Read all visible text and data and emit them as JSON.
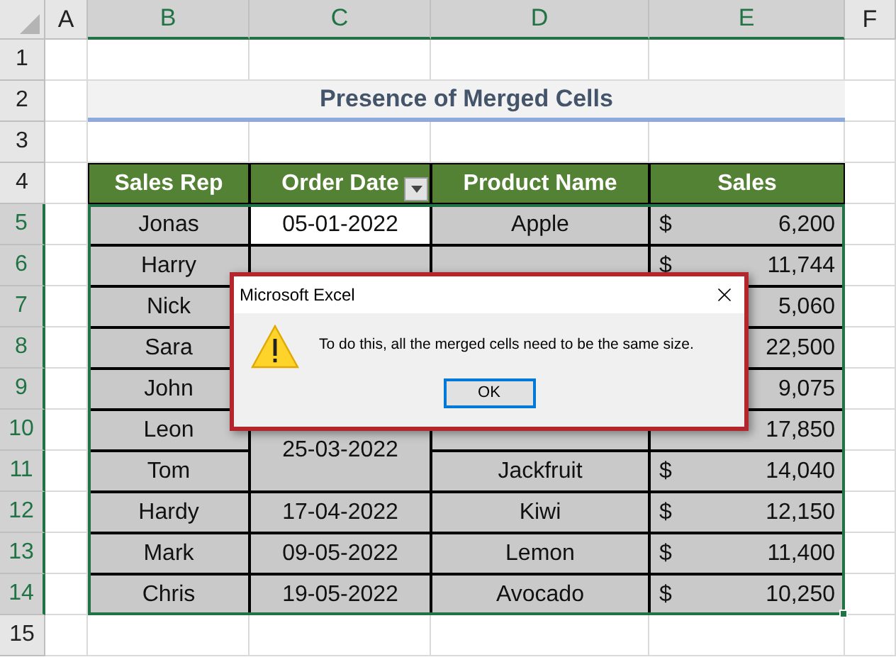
{
  "column_headers": [
    {
      "label": "A",
      "selected": false
    },
    {
      "label": "B",
      "selected": true
    },
    {
      "label": "C",
      "selected": true
    },
    {
      "label": "D",
      "selected": true
    },
    {
      "label": "E",
      "selected": true
    },
    {
      "label": "F",
      "selected": false
    }
  ],
  "row_headers": [
    {
      "label": "1",
      "selected": false
    },
    {
      "label": "2",
      "selected": false
    },
    {
      "label": "3",
      "selected": false
    },
    {
      "label": "4",
      "selected": false
    },
    {
      "label": "5",
      "selected": true
    },
    {
      "label": "6",
      "selected": true
    },
    {
      "label": "7",
      "selected": true
    },
    {
      "label": "8",
      "selected": true
    },
    {
      "label": "9",
      "selected": true
    },
    {
      "label": "10",
      "selected": true
    },
    {
      "label": "11",
      "selected": true
    },
    {
      "label": "12",
      "selected": true
    },
    {
      "label": "13",
      "selected": true
    },
    {
      "label": "14",
      "selected": true
    },
    {
      "label": "15",
      "selected": false
    }
  ],
  "title": "Presence of Merged Cells",
  "table": {
    "columns": [
      {
        "label": "Sales Rep",
        "filter": false
      },
      {
        "label": "Order Date",
        "filter": true
      },
      {
        "label": "Product Name",
        "filter": false
      },
      {
        "label": "Sales",
        "filter": false
      }
    ],
    "rows": [
      {
        "sales_rep": "Jonas",
        "order_date": "05-01-2022",
        "date_active": true,
        "product": "Apple",
        "currency": "$",
        "sales": "6,200"
      },
      {
        "sales_rep": "Harry",
        "currency": "$",
        "sales": "11,744"
      },
      {
        "sales_rep": "Nick",
        "sales": "5,060"
      },
      {
        "sales_rep": "Sara",
        "sales": "22,500"
      },
      {
        "sales_rep": "John",
        "sales": "9,075"
      },
      {
        "sales_rep": "Leon",
        "order_date": "25-03-2022",
        "date_merged_with_next": true,
        "date_active": false,
        "sales": "17,850"
      },
      {
        "sales_rep": "Tom",
        "product": "Jackfruit",
        "currency": "$",
        "sales": "14,040"
      },
      {
        "sales_rep": "Hardy",
        "order_date": "17-04-2022",
        "date_active": false,
        "product": "Kiwi",
        "currency": "$",
        "sales": "12,150"
      },
      {
        "sales_rep": "Mark",
        "order_date": "09-05-2022",
        "date_active": false,
        "product": "Lemon",
        "currency": "$",
        "sales": "11,400"
      },
      {
        "sales_rep": "Chris",
        "order_date": "19-05-2022",
        "date_active": false,
        "product": "Avocado",
        "currency": "$",
        "sales": "10,250"
      }
    ]
  },
  "dialog": {
    "title": "Microsoft Excel",
    "message": "To do this, all the merged cells need to be the same size.",
    "button": {
      "label": "OK",
      "focused": true
    }
  }
}
